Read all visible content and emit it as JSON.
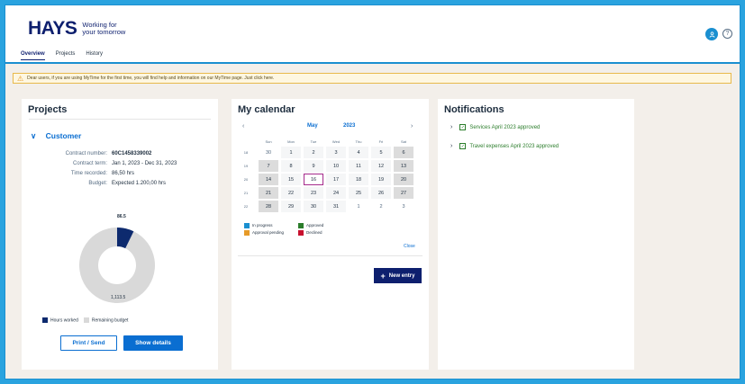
{
  "header": {
    "logo_word": "HAYS",
    "logo_tagline_1": "Working for",
    "logo_tagline_2": "your tomorrow",
    "tabs": [
      {
        "label": "Overview",
        "active": true
      },
      {
        "label": "Projects",
        "active": false
      },
      {
        "label": "History",
        "active": false
      }
    ],
    "avatar_icon": "person-icon",
    "help_icon": "question-icon"
  },
  "banner": {
    "text": "Dear users, if you are using MyTime for the first time, you will find help and information on our MyTime page. Just click here."
  },
  "projects": {
    "title": "Projects",
    "customer_label": "Customer",
    "fields": [
      {
        "label": "Contract number:",
        "value": "60C1458339002"
      },
      {
        "label": "Contract term:",
        "value": "Jan 1, 2023 - Dec 31, 2023"
      },
      {
        "label": "Time recorded:",
        "value": "86,50 hrs"
      },
      {
        "label": "Budget:",
        "value": "Expected 1.200,00 hrs"
      }
    ],
    "chart_data": {
      "type": "pie",
      "categories": [
        "Hours worked",
        "Remaining budget"
      ],
      "values": [
        86.5,
        1113.5
      ],
      "data_labels": [
        "86.5",
        "1,113.5"
      ],
      "colors": [
        "#0d2a6e",
        "#d9d9d9"
      ],
      "legend_position": "bottom-left"
    },
    "print_button": "Print / Send",
    "details_button": "Show details"
  },
  "calendar": {
    "title": "My calendar",
    "month": "May",
    "year": "2023",
    "weekdays": [
      "Sun",
      "Mon",
      "Tue",
      "Wed",
      "Thu",
      "Fri",
      "Sat"
    ],
    "weeks": [
      {
        "num": "18",
        "days": [
          "30",
          "1",
          "2",
          "3",
          "4",
          "5",
          "6"
        ]
      },
      {
        "num": "19",
        "days": [
          "7",
          "8",
          "9",
          "10",
          "11",
          "12",
          "13"
        ]
      },
      {
        "num": "20",
        "days": [
          "14",
          "15",
          "16",
          "17",
          "18",
          "19",
          "20"
        ]
      },
      {
        "num": "21",
        "days": [
          "21",
          "22",
          "23",
          "24",
          "25",
          "26",
          "27"
        ]
      },
      {
        "num": "22",
        "days": [
          "28",
          "29",
          "30",
          "31",
          "1",
          "2",
          "3"
        ]
      }
    ],
    "today": "16",
    "legend": [
      {
        "label": "In progress",
        "color": "#1a8fd0"
      },
      {
        "label": "Approved",
        "color": "#2b7d2b"
      },
      {
        "label": "Approval pending",
        "color": "#e69a28"
      },
      {
        "label": "Declined",
        "color": "#c8102e"
      }
    ],
    "close_label": "Close",
    "new_entry_label": "New entry"
  },
  "notifications": {
    "title": "Notifications",
    "items": [
      "Services April 2023 approved",
      "Travel expenses April 2023 approved"
    ]
  }
}
